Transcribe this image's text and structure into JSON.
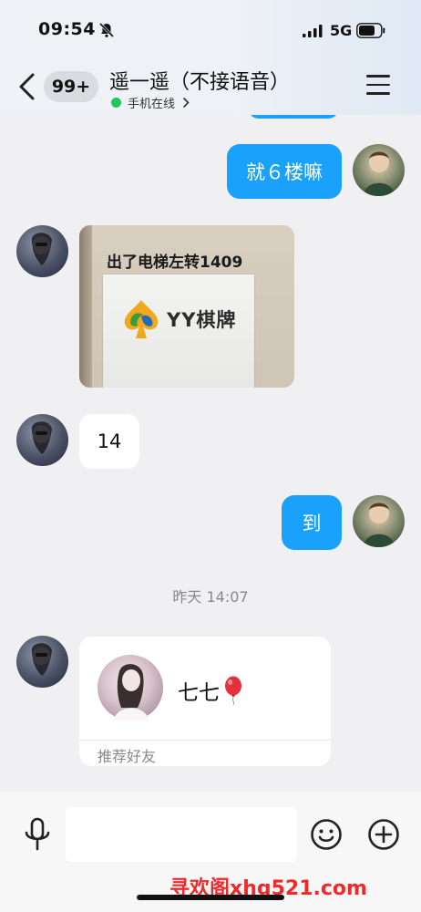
{
  "status_bar": {
    "time": "09:54",
    "network": "5G"
  },
  "header": {
    "unread_count": "99+",
    "title": "遥一遥（不接语音）",
    "status": "手机在线"
  },
  "messages": [
    {
      "type": "text",
      "direction": "outgoing",
      "text": "就６楼嘛"
    },
    {
      "type": "image",
      "direction": "incoming",
      "caption": "出了电梯左转1409",
      "sign_text": "YY棋牌"
    },
    {
      "type": "text",
      "direction": "incoming",
      "text": "14"
    },
    {
      "type": "text",
      "direction": "outgoing",
      "text": "到"
    },
    {
      "type": "timestamp",
      "text": "昨天 14:07"
    },
    {
      "type": "contact_card",
      "direction": "incoming",
      "name": "七七",
      "card_type": "推荐好友"
    }
  ],
  "input": {
    "value": "",
    "placeholder": ""
  },
  "watermark": "寻欢阁xhg521.com",
  "colors": {
    "outgoing_bubble": "#1aa1fb",
    "incoming_bubble": "#ffffff",
    "chat_background": "#f0f0f2",
    "online_dot": "#22c55e",
    "watermark": "#ef2a2a"
  },
  "icons": [
    "bell-muted-icon",
    "signal-icon",
    "battery-icon",
    "back-icon",
    "menu-icon",
    "chevron-right-icon",
    "balloon-icon",
    "mic-icon",
    "emoji-icon",
    "plus-icon"
  ]
}
